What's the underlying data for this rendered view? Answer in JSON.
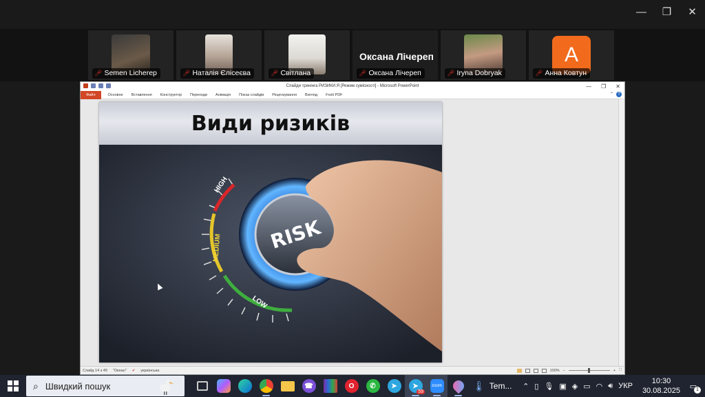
{
  "window_controls": {
    "minimize": "—",
    "restore": "❐",
    "close": "✕"
  },
  "participants": [
    {
      "name": "Semen Licherep",
      "photo": "#5a4a3a"
    },
    {
      "name": "Наталія Єлісеєва",
      "photo": "#8a7a6e"
    },
    {
      "name": "Світлана",
      "photo": "#d9d6cf"
    },
    {
      "name": "Оксана Лічереп",
      "speaker_label": "Оксана Лічереп"
    },
    {
      "name": "Iryna Dobryak",
      "photo": "#a07a6a"
    },
    {
      "name": "Анна Ковтун",
      "avatar_letter": "A"
    }
  ],
  "ppt": {
    "title": "Слайди тренінга РИЗИКИ.Я [Режим сумісності] - Microsoft PowerPoint",
    "file_tab": "Файл",
    "tabs": [
      "Основне",
      "Вставлення",
      "Конструктор",
      "Переходи",
      "Анімація",
      "Показ слайдів",
      "Рецензування",
      "Вигляд",
      "Foxit PDF"
    ],
    "status": {
      "slide": "Слайд 14 з 49",
      "theme": "\"Океан\"",
      "language": "українська",
      "zoom": "100%"
    }
  },
  "slide": {
    "title": "Види ризиків",
    "dial_labels": {
      "center": "RISK",
      "low": "LOW",
      "medium": "MEDIUM",
      "high": "HIGH"
    }
  },
  "taskbar": {
    "search_placeholder": "Швидкий пошук",
    "telegram_badge": "59",
    "zoom_label": "zoom",
    "temp_label": "Tem...",
    "language": "УКР",
    "time": "10:30",
    "date": "30.08.2025",
    "notifications": "1"
  },
  "colors": {
    "accent": "#d24726",
    "taskbar": "#1f2430",
    "avatar": "#f26b1d"
  }
}
